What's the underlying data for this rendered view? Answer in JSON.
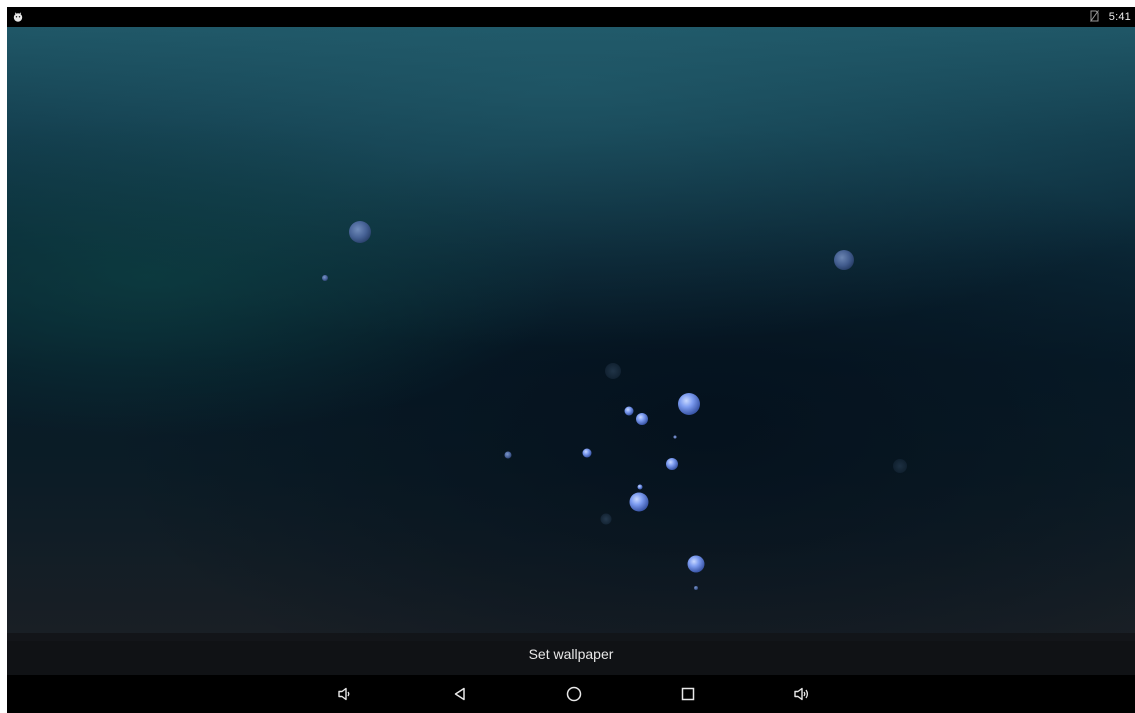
{
  "status_bar": {
    "time": "5:41",
    "left_icon": "android-notification-icon",
    "right_icon": "no-sim-icon"
  },
  "wallpaper": {
    "type": "bubbles-live-wallpaper",
    "accent": "#8fb0ff"
  },
  "action_bar": {
    "set_wallpaper_label": "Set wallpaper"
  },
  "nav_bar": {
    "buttons": [
      "volume-down-icon",
      "back-icon",
      "home-icon",
      "recents-icon",
      "volume-up-icon"
    ]
  },
  "colors": {
    "status_bg": "#000000",
    "nav_bg": "#000000",
    "text": "#e8e8e8"
  }
}
